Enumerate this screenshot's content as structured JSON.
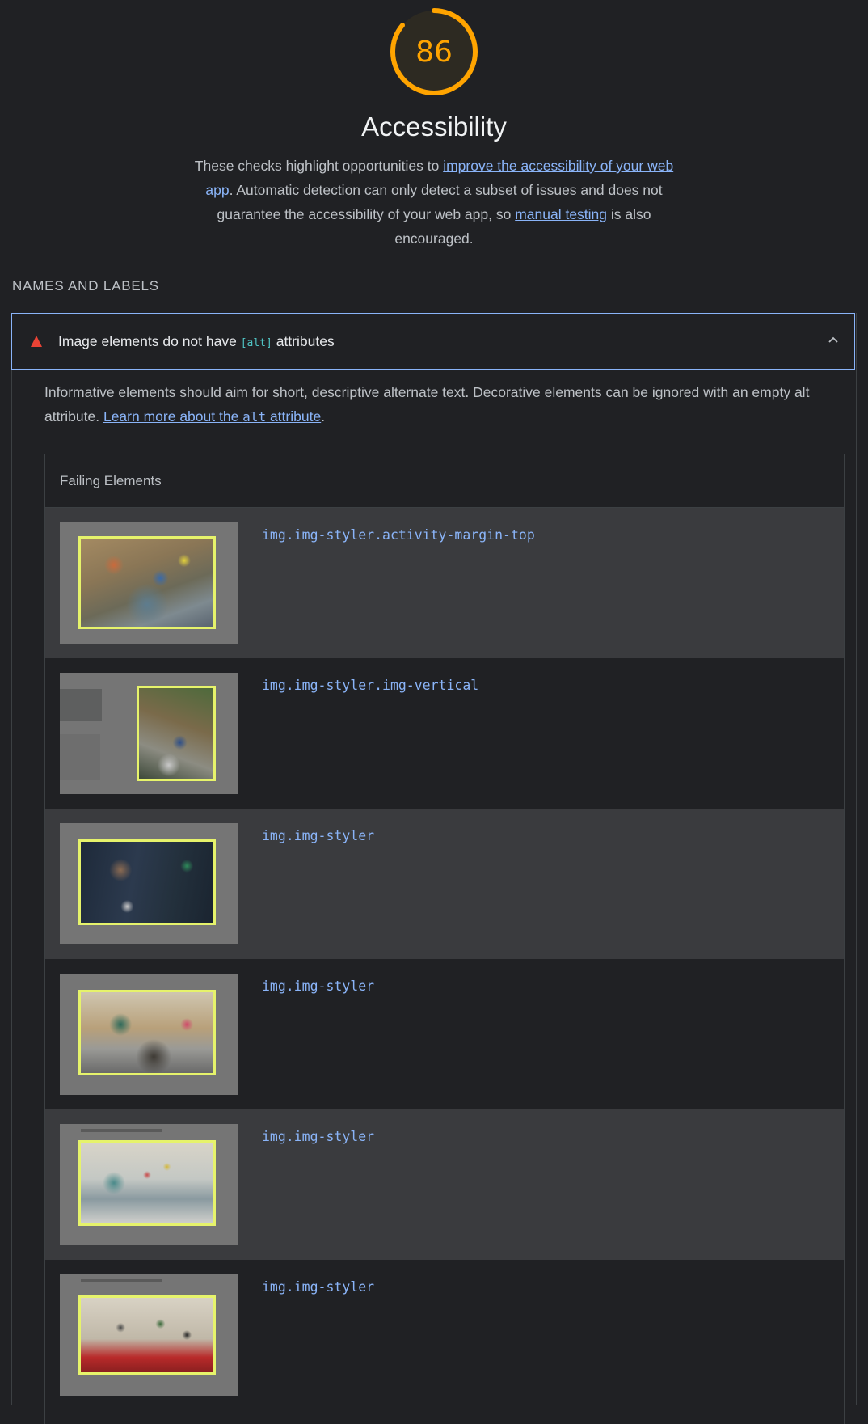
{
  "score": {
    "value": "86",
    "fraction": 0.86,
    "color": "#ffa400"
  },
  "title": "Accessibility",
  "description": {
    "part1": "These checks highlight opportunities to ",
    "link1": "improve the accessibility of your web app",
    "part2": ". Automatic detection can only detect a subset of issues and does not guarantee the accessibility of your web app, so ",
    "link2": "manual testing",
    "part3": " is also encouraged."
  },
  "group_title": "NAMES AND LABELS",
  "audit": {
    "title_before": "Image elements do not have ",
    "title_code": "[alt]",
    "title_after": " attributes",
    "status_icon": "warning-triangle-icon",
    "status_color": "#ea4335",
    "expand_icon": "chevron-up-icon",
    "desc_text": "Informative elements should aim for short, descriptive alternate text. Decorative elements can be ignored with an empty alt attribute. ",
    "desc_link_before": "Learn more about the ",
    "desc_link_code": "alt",
    "desc_link_after": " attribute",
    "desc_end": "."
  },
  "table": {
    "header": "Failing Elements",
    "rows": [
      {
        "selector": "img.img-styler.activity-margin-top"
      },
      {
        "selector": "img.img-styler.img-vertical"
      },
      {
        "selector": "img.img-styler"
      },
      {
        "selector": "img.img-styler"
      },
      {
        "selector": "img.img-styler"
      },
      {
        "selector": "img.img-styler"
      }
    ]
  }
}
